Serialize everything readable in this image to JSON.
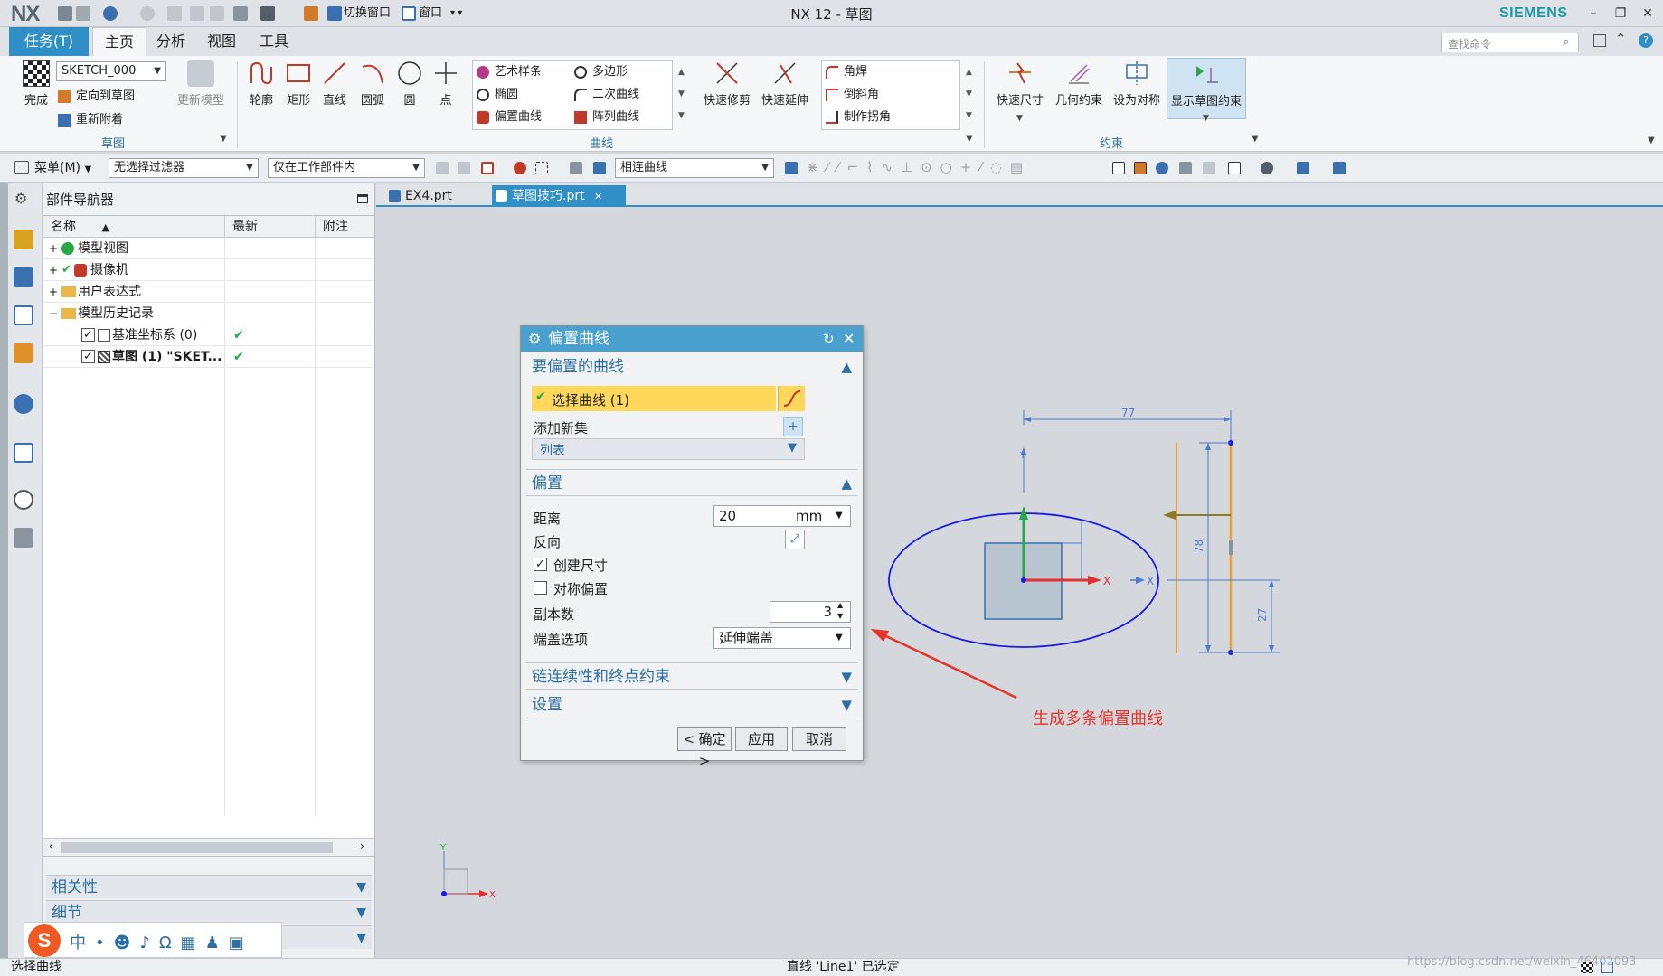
{
  "app": {
    "logo": "NX",
    "title": "NX 12 - 草图",
    "brand": "SIEMENS",
    "quick_switch_window": "切换窗口",
    "quick_window": "窗口"
  },
  "tabs": {
    "task": "任务(T)",
    "items": [
      "主页",
      "分析",
      "视图",
      "工具"
    ],
    "active": "主页",
    "command_search_placeholder": "查找命令"
  },
  "ribbon": {
    "sketch": {
      "finish": "完成",
      "sketch_name": "SKETCH_000",
      "orient": "定向到草图",
      "reattach": "重新附着",
      "update_model": "更新模型",
      "group_label": "草图"
    },
    "curve": {
      "big": [
        "轮廓",
        "矩形",
        "直线",
        "圆弧",
        "圆",
        "点"
      ],
      "gallery_col1": [
        "艺术样条",
        "椭圆",
        "偏置曲线"
      ],
      "gallery_col2": [
        "多边形",
        "二次曲线",
        "阵列曲线"
      ],
      "quick_trim": "快速修剪",
      "quick_extend": "快速延伸",
      "gallery2": [
        "角焊",
        "倒斜角",
        "制作拐角"
      ],
      "group_label": "曲线"
    },
    "constraint": {
      "items": [
        "快速尺寸",
        "几何约束",
        "设为对称",
        "显示草图约束"
      ],
      "group_label": "约束"
    }
  },
  "selection_bar": {
    "menu": "菜单(M)",
    "filter": "无选择过滤器",
    "scope": "仅在工作部件内",
    "curve_rule": "相连曲线"
  },
  "navigator": {
    "title": "部件导航器",
    "columns": [
      "名称",
      "最新",
      "附注"
    ],
    "rows": [
      {
        "label": "模型视图",
        "check": ""
      },
      {
        "label": "摄像机",
        "check": ""
      },
      {
        "label": "用户表达式",
        "check": ""
      },
      {
        "label": "模型历史记录",
        "check": ""
      },
      {
        "label": "基准坐标系 (0)",
        "check": "✔"
      },
      {
        "label": "草图 (1) \"SKET...",
        "check": "✔"
      }
    ],
    "sections": [
      "相关性",
      "细节"
    ]
  },
  "doc_tabs": [
    "EX4.prt",
    "草图技巧.prt"
  ],
  "dialog": {
    "title": "偏置曲线",
    "sec_curve": "要偏置的曲线",
    "select_curve": "选择曲线 (1)",
    "add_new_set": "添加新集",
    "list": "列表",
    "sec_offset": "偏置",
    "distance_label": "距离",
    "distance_value": "20",
    "distance_unit": "mm",
    "reverse_label": "反向",
    "create_dim": "创建尺寸",
    "create_dim_checked": true,
    "symmetric": "对称偏置",
    "symmetric_checked": false,
    "copies_label": "副本数",
    "copies_value": "3",
    "cap_label": "端盖选项",
    "cap_value": "延伸端盖",
    "sec_chain": "链连续性和终点约束",
    "sec_settings": "设置",
    "ok": "< 确定 >",
    "apply": "应用",
    "cancel": "取消"
  },
  "sketch": {
    "dim_top": "77",
    "dim_height": "78",
    "dim_small": "27",
    "annotation": "生成多条偏置曲线",
    "x_label": "X",
    "y_label": "Y"
  },
  "status": {
    "left": "选择曲线",
    "center": "直线 'Line1' 已选定",
    "watermark": "https://blog.csdn.net/weixin_46402093"
  },
  "colors": {
    "accent": "#2f8fc6",
    "dialog_title": "#4aa0cf",
    "selection_highlight": "#ffd75a",
    "ellipse": "#1a1ae6",
    "offset_curve": "#f0a030",
    "annotation": "#e8332a"
  }
}
